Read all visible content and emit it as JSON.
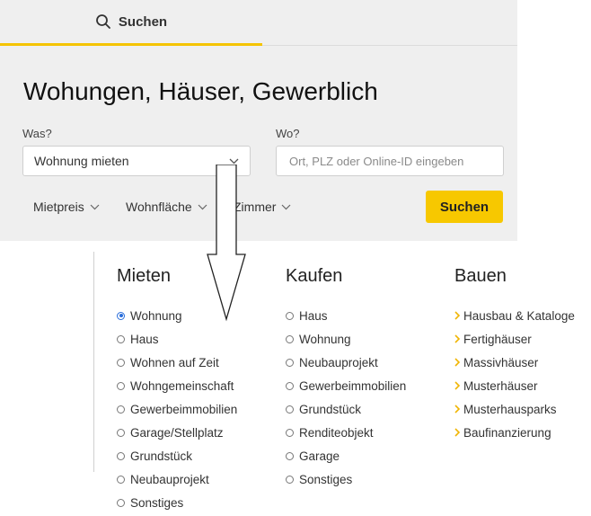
{
  "tab": {
    "label": "Suchen",
    "icon": "search-icon"
  },
  "headline": "Wohungen, Häuser, Gewerblich",
  "was": {
    "label": "Was?",
    "value": "Wohnung mieten"
  },
  "wo": {
    "label": "Wo?",
    "placeholder": "Ort, PLZ oder Online-ID eingeben"
  },
  "filters": {
    "mietpreis": "Mietpreis",
    "wohnflaeche": "Wohnfläche",
    "zimmer": "Zimmer"
  },
  "search_button": "Suchen",
  "colors": {
    "accent": "#f7c800",
    "radio_selected": "#2a6edb",
    "caret": "#f0b400"
  },
  "dropdown": {
    "mieten": {
      "title": "Mieten",
      "options": [
        "Wohnung",
        "Haus",
        "Wohnen auf Zeit",
        "Wohngemeinschaft",
        "Gewerbeimmobilien",
        "Garage/Stellplatz",
        "Grundstück",
        "Neubauprojekt",
        "Sonstiges"
      ],
      "selected": "Wohnung"
    },
    "kaufen": {
      "title": "Kaufen",
      "options": [
        "Haus",
        "Wohnung",
        "Neubauprojekt",
        "Gewerbeimmobilien",
        "Grundstück",
        "Renditeobjekt",
        "Garage",
        "Sonstiges"
      ]
    },
    "bauen": {
      "title": "Bauen",
      "links": [
        "Hausbau & Kataloge",
        "Fertighäuser",
        "Massivhäuser",
        "Musterhäuser",
        "Musterhausparks",
        "Baufinanzierung"
      ]
    }
  }
}
